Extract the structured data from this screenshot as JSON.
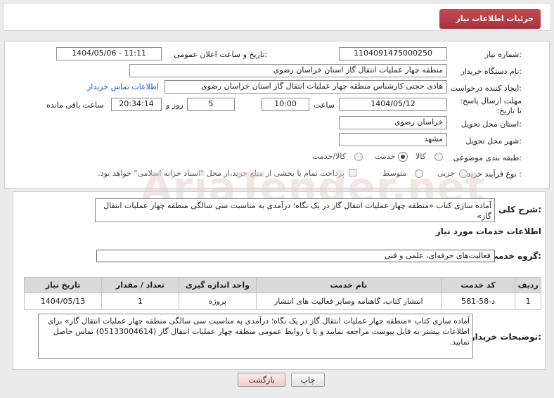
{
  "header": {
    "title": "جزئیات اطلاعات نیاز"
  },
  "form": {
    "need_number_label": "شماره نیاز:",
    "need_number": "1104091475000250",
    "announce_label": "تاریخ و ساعت اعلان عمومی:",
    "announce_value": "1404/05/06 - 11:11",
    "buyer_org_label": "نام دستگاه خریدار:",
    "buyer_org": "منطقه چهار عملیات انتقال گاز    استان خراسان رضوی",
    "creator_label": "ایجاد کننده درخواست:",
    "creator": "هادی حجتی کارشناس منطقه چهار عملیات انتقال گاز    استان خراسان رضوی",
    "contact_link": "اطلاعات تماس خریدار",
    "deadline_label": "مهلت ارسال پاسخ: تا تاریخ:",
    "deadline_date": "1404/05/12",
    "time_label": "ساعت",
    "deadline_time": "10:00",
    "days_value": "5",
    "days_label": "روز و",
    "remaining_time": "20:34:14",
    "remaining_label": "ساعت باقی مانده",
    "province_label": "استان محل تحویل:",
    "province": "خراسان رضوی",
    "city_label": "شهر محل تحویل:",
    "city": "مشهد",
    "category_label": "طبقه بندی موضوعی:",
    "category_options": [
      "کالا",
      "خدمت",
      "کالا/خدمت"
    ],
    "category_selected": "خدمت",
    "process_label": "نوع فرآیند خرید :",
    "process_options": [
      "جزیی",
      "متوسط"
    ],
    "payment_note": "پرداخت تمام یا بخشی از مبلغ خرید،از محل \"اسناد خزانه اسلامی\" خواهد بود."
  },
  "details": {
    "general_desc_label": "شرح کلی نیاز:",
    "general_desc": "آماده سازی کتاب «منطقه چهار عملیات انتقال گاز در یک نگاه؛ درآمدی به مناسبت سی سالگی منطقه چهار عملیات انتقال گاز»",
    "services_header": "اطلاعات خدمات مورد نیاز",
    "service_group_label": "گروه خدمت:",
    "service_group": "فعالیت‌های حرفه‌ای، علمی و فنی",
    "table": {
      "headers": [
        "ردیف",
        "کد خدمت",
        "نام خدمت",
        "واحد اندازه گیری",
        "تعداد / مقدار",
        "تاریخ نیاز"
      ],
      "rows": [
        [
          "1",
          "د-58-581",
          "انتشار کتاب، گاهنامه وسایر فعالیت های انتشار",
          "پروژه",
          "1",
          "1404/05/13"
        ]
      ]
    },
    "buyer_notes_label": "توضیحات خریدار:",
    "buyer_notes": "آماده سازی کتاب «منطقه چهار عملیات انتقال گاز در یک نگاه؛ درآمدی به مناسبت سی سالگی منطقه چهار عملیات انتقال گاز» برای اطلاعات بیشتر به فایل پیوست مراجعه نمایید و یا با روابط عمومی منطقه چهار عملیات انتقال گاز (05133004614) تماس حاصل نمایید."
  },
  "buttons": {
    "print": "چاپ",
    "back": "بازگشت"
  },
  "watermark": "AriaTender.net"
}
